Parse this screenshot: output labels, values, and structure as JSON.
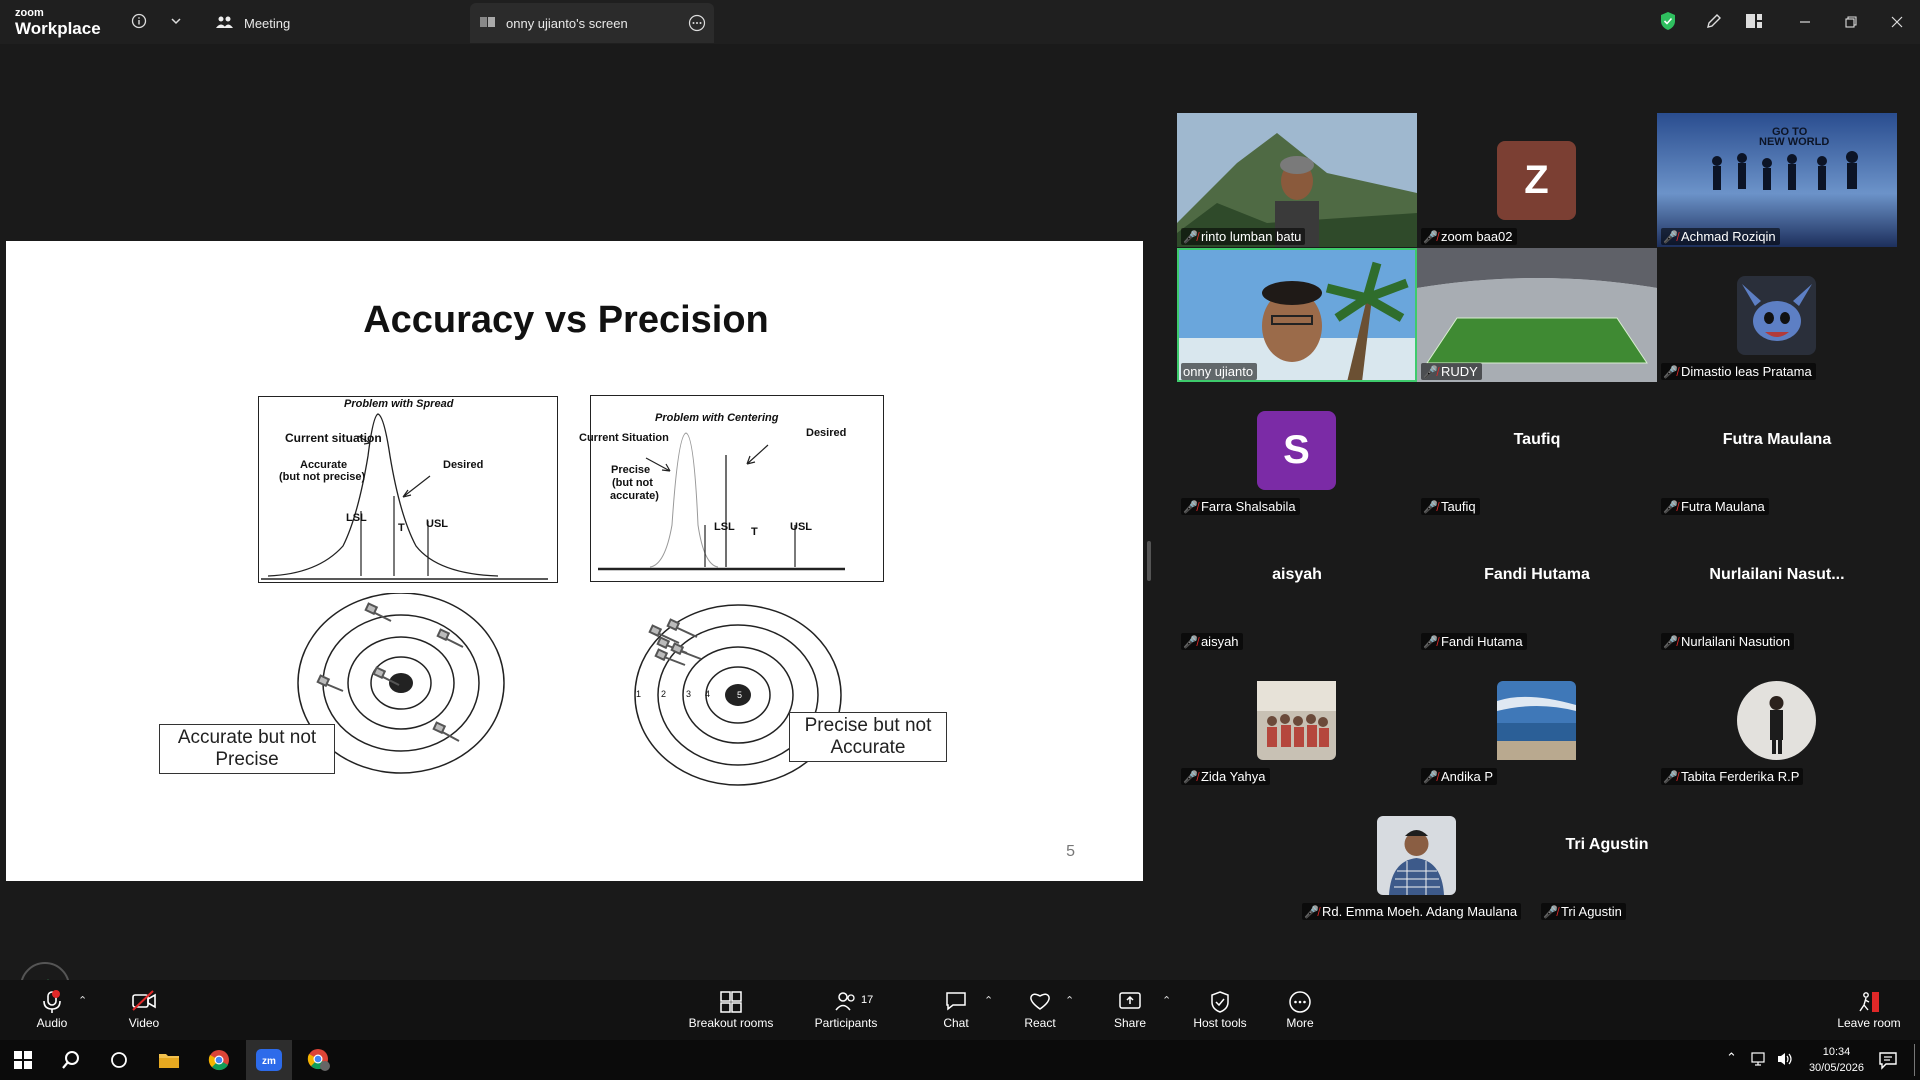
{
  "app": {
    "brand_top": "zoom",
    "brand_bottom": "Workplace"
  },
  "titlebar": {
    "meeting_tab": "Meeting",
    "screen_tab": "onny ujianto's screen"
  },
  "slide": {
    "title": "Accuracy vs Precision",
    "left_box_title": "Problem with Spread",
    "left_current": "Current situation",
    "left_accurate": "Accurate",
    "left_accurate2": "(but not precise)",
    "left_desired": "Desired",
    "left_lsl": "LSL",
    "left_t": "T",
    "left_usl": "USL",
    "right_box_title": "Problem with Centering",
    "right_current": "Current Situation",
    "right_desired": "Desired",
    "right_precise": "Precise",
    "right_precise2": "(but not",
    "right_precise3": "accurate)",
    "right_lsl": "LSL",
    "right_t": "T",
    "right_usl": "USL",
    "caption_left_1": "Accurate but not",
    "caption_left_2": "Precise",
    "caption_right_1": "Precise but not",
    "caption_right_2": "Accurate",
    "ring_labels": [
      "1",
      "2",
      "3",
      "4",
      "5"
    ],
    "page_number": "5"
  },
  "participants": [
    {
      "name": "rinto lumban batu"
    },
    {
      "name": "zoom baa02",
      "initial": "Z"
    },
    {
      "name": "Achmad Roziqin"
    },
    {
      "name": "onny ujianto"
    },
    {
      "name": "RUDY"
    },
    {
      "name": "Dimastio leas Pratama"
    },
    {
      "name": "Farra Shalsabila",
      "initial": "S"
    },
    {
      "name": "Taufiq",
      "display": "Taufiq"
    },
    {
      "name": "Futra Maulana",
      "display": "Futra Maulana"
    },
    {
      "name": "aisyah",
      "display": "aisyah"
    },
    {
      "name": "Fandi Hutama",
      "display": "Fandi Hutama"
    },
    {
      "name": "Nurlailani Nasution",
      "display": "Nurlailani  Nasut..."
    },
    {
      "name": "Zida Yahya"
    },
    {
      "name": "Andika P"
    },
    {
      "name": "Tabita Ferderika R.P"
    },
    {
      "name": "Rd. Emma Moeh. Adang Maulana"
    },
    {
      "name": "Tri Agustin",
      "display": "Tri Agustin"
    }
  ],
  "toolbar": {
    "audio": "Audio",
    "video": "Video",
    "breakout": "Breakout rooms",
    "participants": "Participants",
    "participants_count": "17",
    "chat": "Chat",
    "react": "React",
    "share": "Share",
    "host_tools": "Host tools",
    "more": "More",
    "leave": "Leave room"
  },
  "taskbar": {
    "time": "10:34",
    "date": "30/05/2026"
  },
  "colors": {
    "accent_green": "#3ecb6c",
    "mic_off_red": "#e02828",
    "avatar_brown": "#7b3f33",
    "avatar_purple": "#7b2ba6"
  }
}
